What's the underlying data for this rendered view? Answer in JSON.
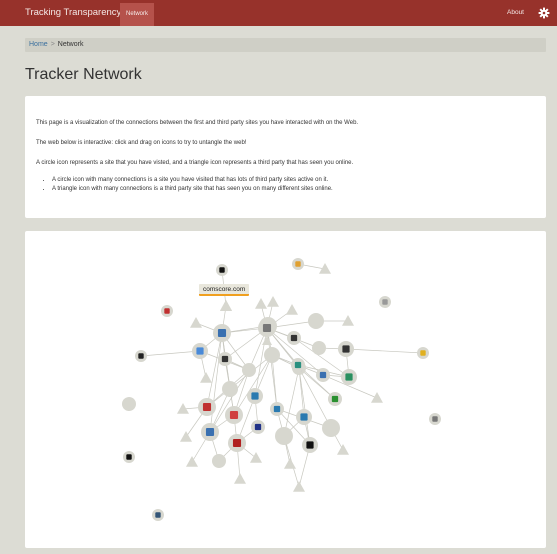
{
  "header": {
    "brand": "Tracking Transparency",
    "nav_tab": "Network",
    "about_link": "About",
    "settings_icon": "gear-icon",
    "bg_color": "#97322b"
  },
  "breadcrumb": {
    "home": "Home",
    "separator": ">",
    "current": "Network"
  },
  "page_title": "Tracker Network",
  "intro": {
    "paragraphs": [
      "This page is a visualization of the connections between the first and third party sites you have interacted with on the Web.",
      "The web below is interactive: click and drag on icons to try to untangle the web!",
      "A circle icon represents a site that you have visted, and a triangle icon represents a third party that has seen you online."
    ],
    "bullets": [
      "A circle icon with many connections is a site you have visited that has lots of third party sites active on it.",
      "A triangle icon with many connections is a third party site that has seen you on many different sites online."
    ]
  },
  "network": {
    "tooltip": "comscore.com",
    "highlight_color": "#f0a020",
    "node_color": "#d7d7cf",
    "link_color": "#c8c8c0"
  }
}
